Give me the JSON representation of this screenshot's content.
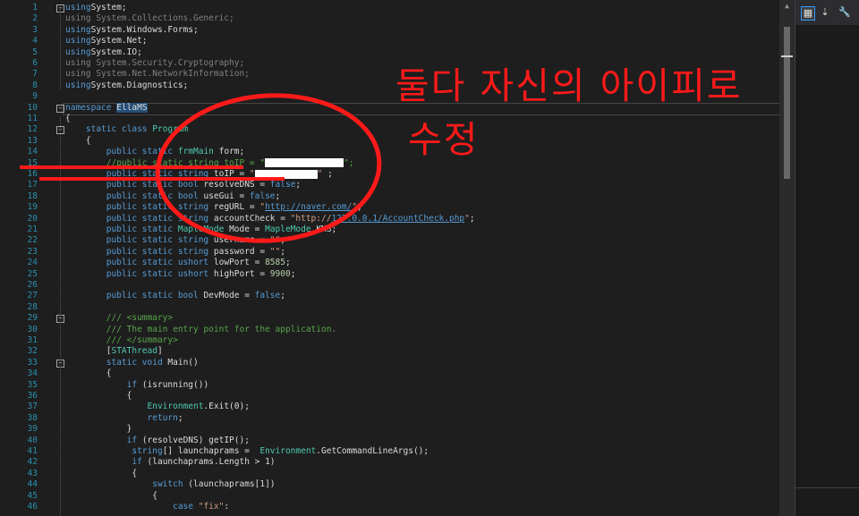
{
  "editor": {
    "lines": [
      {
        "n": "1",
        "s": [
          [
            "kw",
            "using"
          ],
          [
            "",
            "System;"
          ]
        ]
      },
      {
        "n": "2",
        "s": [
          [
            "dim",
            "using System.Collections.Generic;"
          ]
        ]
      },
      {
        "n": "3",
        "s": [
          [
            "kw",
            "using"
          ],
          [
            "",
            "System.Windows.Forms;"
          ]
        ]
      },
      {
        "n": "4",
        "s": [
          [
            "kw",
            "using"
          ],
          [
            "",
            "System.Net;"
          ]
        ]
      },
      {
        "n": "5",
        "s": [
          [
            "kw",
            "using"
          ],
          [
            "",
            "System.IO;"
          ]
        ]
      },
      {
        "n": "6",
        "s": [
          [
            "dim",
            "using System.Security.Cryptography;"
          ]
        ]
      },
      {
        "n": "7",
        "s": [
          [
            "dim",
            "using System.Net.NetworkInformation;"
          ]
        ]
      },
      {
        "n": "8",
        "s": [
          [
            "kw",
            "using"
          ],
          [
            "",
            "System.Diagnostics;"
          ]
        ]
      },
      {
        "n": "9",
        "s": []
      },
      {
        "n": "10",
        "s": [
          [
            "kw",
            "namespace"
          ],
          [
            "",
            " "
          ],
          [
            "hl",
            "EllaMS"
          ]
        ]
      },
      {
        "n": "11",
        "s": [
          [
            "",
            "{"
          ]
        ]
      },
      {
        "n": "12",
        "s": [
          [
            "",
            "    "
          ],
          [
            "kw",
            "static class"
          ],
          [
            "",
            " "
          ],
          [
            "ty",
            "Program"
          ]
        ]
      },
      {
        "n": "13",
        "s": [
          [
            "",
            "    {"
          ]
        ]
      },
      {
        "n": "14",
        "s": [
          [
            "",
            "        "
          ],
          [
            "kw",
            "public static"
          ],
          [
            "",
            " "
          ],
          [
            "ty",
            "frmMain"
          ],
          [
            "",
            " form;"
          ]
        ]
      },
      {
        "n": "15",
        "s": [
          [
            "",
            "        "
          ],
          [
            "cm",
            "//public static string toIP = \""
          ],
          [
            "redact",
            ""
          ],
          [
            "cm",
            "\";"
          ]
        ]
      },
      {
        "n": "16",
        "s": [
          [
            "",
            "        "
          ],
          [
            "kw",
            "public static string"
          ],
          [
            "",
            " toIP = "
          ],
          [
            "str",
            "\""
          ],
          [
            "redact",
            ""
          ],
          [
            "str",
            "\""
          ],
          [
            "",
            " ;"
          ]
        ]
      },
      {
        "n": "17",
        "s": [
          [
            "",
            "        "
          ],
          [
            "kw",
            "public static bool"
          ],
          [
            "",
            " resolveDNS = "
          ],
          [
            "kw",
            "false"
          ],
          [
            "",
            ";"
          ]
        ]
      },
      {
        "n": "18",
        "s": [
          [
            "",
            "        "
          ],
          [
            "kw",
            "public static bool"
          ],
          [
            "",
            " useGui = "
          ],
          [
            "kw",
            "false"
          ],
          [
            "",
            ";"
          ]
        ]
      },
      {
        "n": "19",
        "s": [
          [
            "",
            "        "
          ],
          [
            "kw",
            "public static string"
          ],
          [
            "",
            " regURL = "
          ],
          [
            "str",
            "\""
          ],
          [
            "link",
            "http://naver.com/"
          ],
          [
            "str",
            "\""
          ],
          [
            "",
            ";"
          ]
        ]
      },
      {
        "n": "20",
        "s": [
          [
            "",
            "        "
          ],
          [
            "kw",
            "public static string"
          ],
          [
            "",
            " accountCheck = "
          ],
          [
            "str",
            "\"http://"
          ],
          [
            "link",
            "127.0.0.1/AccountCheck.php"
          ],
          [
            "str",
            "\""
          ],
          [
            "",
            ";"
          ]
        ]
      },
      {
        "n": "21",
        "s": [
          [
            "",
            "        "
          ],
          [
            "kw",
            "public static"
          ],
          [
            "",
            " "
          ],
          [
            "ty",
            "MapleMode"
          ],
          [
            "",
            " Mode = "
          ],
          [
            "ty",
            "MapleMode"
          ],
          [
            "",
            ".KMS;"
          ]
        ]
      },
      {
        "n": "22",
        "s": [
          [
            "",
            "        "
          ],
          [
            "kw",
            "public static string"
          ],
          [
            "",
            " username = "
          ],
          [
            "str",
            "\"\""
          ],
          [
            "",
            ";"
          ]
        ]
      },
      {
        "n": "23",
        "s": [
          [
            "",
            "        "
          ],
          [
            "kw",
            "public static string"
          ],
          [
            "",
            " password = "
          ],
          [
            "str",
            "\"\""
          ],
          [
            "",
            ";"
          ]
        ]
      },
      {
        "n": "24",
        "s": [
          [
            "",
            "        "
          ],
          [
            "kw",
            "public static ushort"
          ],
          [
            "",
            " lowPort = "
          ],
          [
            "num",
            "8585"
          ],
          [
            "",
            ";"
          ]
        ]
      },
      {
        "n": "25",
        "s": [
          [
            "",
            "        "
          ],
          [
            "kw",
            "public static ushort"
          ],
          [
            "",
            " highPort = "
          ],
          [
            "num",
            "9900"
          ],
          [
            "",
            ";"
          ]
        ]
      },
      {
        "n": "26",
        "s": []
      },
      {
        "n": "27",
        "s": [
          [
            "",
            "        "
          ],
          [
            "kw",
            "public static bool"
          ],
          [
            "",
            " DevMode = "
          ],
          [
            "kw",
            "false"
          ],
          [
            "",
            ";"
          ]
        ]
      },
      {
        "n": "28",
        "s": []
      },
      {
        "n": "29",
        "s": [
          [
            "",
            "        "
          ],
          [
            "cm",
            "/// <summary>"
          ]
        ]
      },
      {
        "n": "30",
        "s": [
          [
            "",
            "        "
          ],
          [
            "cm",
            "/// The main entry point for the application."
          ]
        ]
      },
      {
        "n": "31",
        "s": [
          [
            "",
            "        "
          ],
          [
            "cm",
            "/// </summary>"
          ]
        ]
      },
      {
        "n": "32",
        "s": [
          [
            "",
            "        ["
          ],
          [
            "ty",
            "STAThread"
          ],
          [
            "",
            "]"
          ]
        ]
      },
      {
        "n": "33",
        "s": [
          [
            "",
            "        "
          ],
          [
            "kw",
            "static void"
          ],
          [
            "",
            " Main()"
          ]
        ]
      },
      {
        "n": "34",
        "s": [
          [
            "",
            "        {"
          ]
        ]
      },
      {
        "n": "35",
        "s": [
          [
            "",
            "            "
          ],
          [
            "kw",
            "if"
          ],
          [
            "",
            " (isrunning())"
          ]
        ]
      },
      {
        "n": "36",
        "s": [
          [
            "",
            "            {"
          ]
        ]
      },
      {
        "n": "37",
        "s": [
          [
            "",
            "                "
          ],
          [
            "ty",
            "Environment"
          ],
          [
            "",
            ".Exit(0);"
          ]
        ]
      },
      {
        "n": "38",
        "s": [
          [
            "",
            "                "
          ],
          [
            "kw",
            "return"
          ],
          [
            "",
            ";"
          ]
        ]
      },
      {
        "n": "39",
        "s": [
          [
            "",
            "            }"
          ]
        ]
      },
      {
        "n": "40",
        "s": [
          [
            "",
            "            "
          ],
          [
            "kw",
            "if"
          ],
          [
            "",
            " (resolveDNS) getIP();"
          ]
        ]
      },
      {
        "n": "41",
        "s": [
          [
            "",
            "             "
          ],
          [
            "kw",
            "string"
          ],
          [
            "",
            "[] launchaprams =  "
          ],
          [
            "ty",
            "Environment"
          ],
          [
            "",
            ".GetCommandLineArgs();"
          ]
        ]
      },
      {
        "n": "42",
        "s": [
          [
            "",
            "             "
          ],
          [
            "kw",
            "if"
          ],
          [
            "",
            " (launchaprams.Length > 1)"
          ]
        ]
      },
      {
        "n": "43",
        "s": [
          [
            "",
            "             {"
          ]
        ]
      },
      {
        "n": "44",
        "s": [
          [
            "",
            "                 "
          ],
          [
            "kw",
            "switch"
          ],
          [
            "",
            " (launchaprams[1])"
          ]
        ]
      },
      {
        "n": "45",
        "s": [
          [
            "",
            "                 {"
          ]
        ]
      },
      {
        "n": "46",
        "s": [
          [
            "",
            "                     "
          ],
          [
            "kw",
            "case"
          ],
          [
            "",
            " "
          ],
          [
            "str",
            "\"fix\""
          ],
          [
            "",
            ":"
          ]
        ]
      }
    ]
  },
  "annotation": {
    "line1": "둘다 자신의 아이피로",
    "line2": "수정"
  },
  "toolbar": {
    "icons": [
      "properties-view-icon",
      "sort-alphabetical-icon",
      "wrench-icon"
    ]
  },
  "colors": {
    "annotation": "#ff1a1a",
    "keyword": "#569cd6",
    "type": "#4ec9b0"
  }
}
